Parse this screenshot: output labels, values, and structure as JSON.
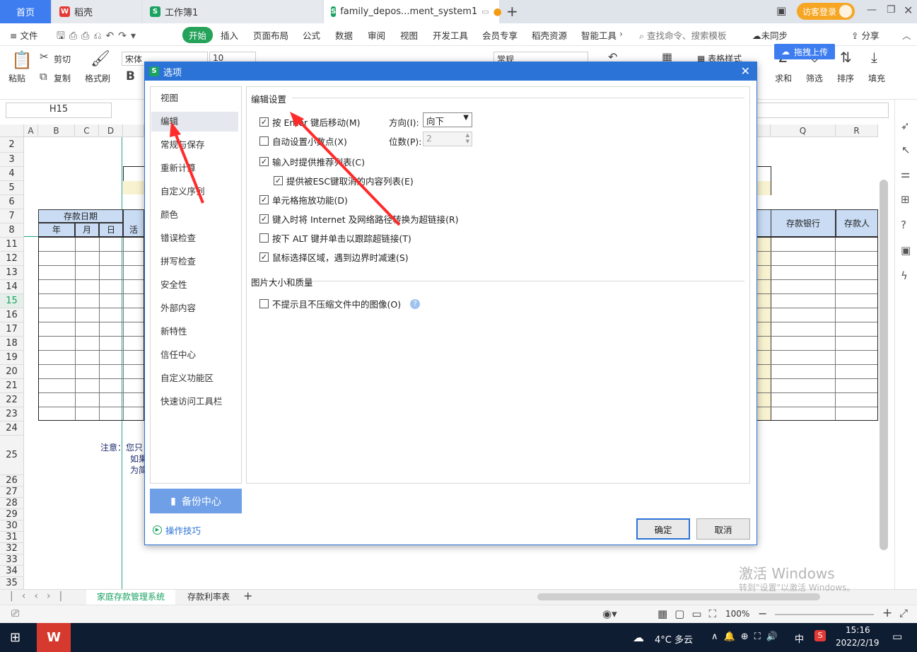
{
  "tabs": {
    "home": "首页",
    "daoke": "稻壳",
    "workbook1": "工作簿1",
    "file": "family_depos...ment_system1",
    "login": "访客登录"
  },
  "menu": {
    "file": "文件",
    "items": [
      "开始",
      "插入",
      "页面布局",
      "公式",
      "数据",
      "审阅",
      "视图",
      "开发工具",
      "会员专享",
      "稻壳资源",
      "智能工具"
    ],
    "search": "查找命令、搜索模板",
    "sync": "未同步",
    "share": "分享",
    "upload": "拖拽上传"
  },
  "ribbon": {
    "paste": "粘贴",
    "cut": "剪切",
    "copy": "复制",
    "format_painter": "格式刷",
    "font": "宋体",
    "size": "10",
    "number_format": "常规",
    "table_style": "表格样式",
    "sum": "求和",
    "filter": "筛选",
    "sort": "排序",
    "fill": "填充"
  },
  "formula_bar": {
    "cell_ref": "H15"
  },
  "grid": {
    "columns": [
      "A",
      "B",
      "C",
      "D",
      "Q",
      "R"
    ],
    "rows": [
      "2",
      "3",
      "4",
      "5",
      "6",
      "7",
      "8",
      "11",
      "12",
      "13",
      "14",
      "15",
      "16",
      "17",
      "18",
      "19",
      "20",
      "21",
      "22",
      "23",
      "24",
      "25",
      "26",
      "27",
      "28",
      "29",
      "30",
      "31",
      "32",
      "33",
      "34",
      "35"
    ],
    "header_date": "存款日期",
    "header_year": "年",
    "header_month": "月",
    "header_day": "日",
    "header_live": "活",
    "header_bank": "存款银行",
    "header_depositor": "存款人",
    "note_label": "注意：您只",
    "note_line2": "如果",
    "note_line3": "为简"
  },
  "sheets": {
    "tab1": "家庭存款管理系统",
    "tab2": "存款利率表"
  },
  "status": {
    "zoom": "100%",
    "watermark1": "激活 Windows",
    "watermark2": "转到\"设置\"以激活 Windows。"
  },
  "taskbar": {
    "weather": "4°C 多云",
    "ime": "中",
    "time": "15:16",
    "date": "2022/2/19"
  },
  "dialog": {
    "title": "选项",
    "nav": [
      "视图",
      "编辑",
      "常规与保存",
      "重新计算",
      "自定义序列",
      "颜色",
      "错误检查",
      "拼写检查",
      "安全性",
      "外部内容",
      "新特性",
      "信任中心",
      "自定义功能区",
      "快速访问工具栏"
    ],
    "backup": "备份中心",
    "tips": "操作技巧",
    "section_edit": "编辑设置",
    "opt_enter_move": "按 Enter 键后移动(M)",
    "direction_label": "方向(I):",
    "direction_value": "向下",
    "opt_auto_decimal": "自动设置小数点(X)",
    "digits_label": "位数(P):",
    "digits_value": "2",
    "opt_autocomplete": "输入时提供推荐列表(C)",
    "opt_esc_list": "提供被ESC键取消的内容列表(E)",
    "opt_drag": "单元格拖放功能(D)",
    "opt_hyperlink": "键入时将 Internet 及网络路径转换为超链接(R)",
    "opt_alt_click": "按下 ALT 键并单击以跟踪超链接(T)",
    "opt_slowdown": "鼠标选择区域，遇到边界时减速(S)",
    "section_image": "图片大小和质量",
    "opt_no_compress": "不提示且不压缩文件中的图像(O)",
    "ok": "确定",
    "cancel": "取消"
  },
  "colors": {
    "accent_blue": "#2b73d6",
    "start_green": "#25a25a",
    "header_blue": "#c9dcf4",
    "light_yellow": "#f8f2d0",
    "annotation_red": "#ff2a2a"
  }
}
